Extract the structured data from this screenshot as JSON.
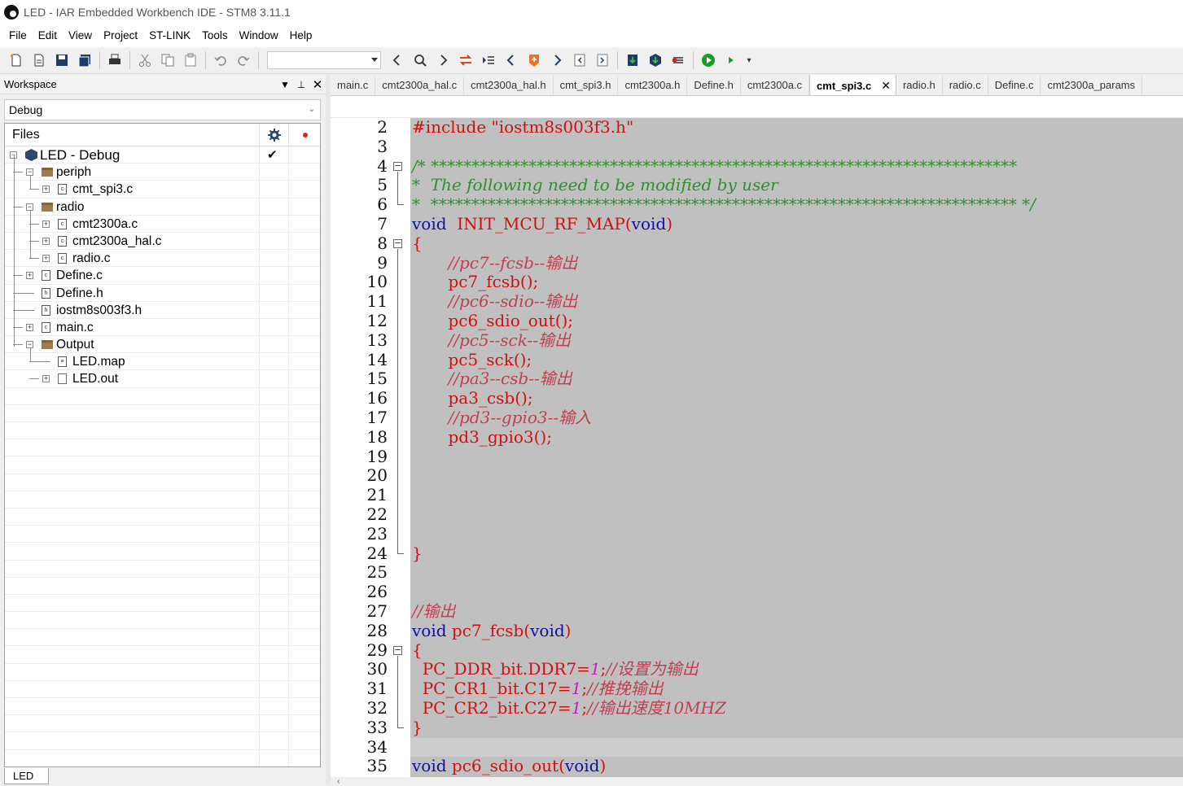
{
  "window": {
    "title": "LED - IAR Embedded Workbench IDE - STM8 3.11.1"
  },
  "menu": [
    "File",
    "Edit",
    "View",
    "Project",
    "ST-LINK",
    "Tools",
    "Window",
    "Help"
  ],
  "workspace": {
    "title": "Workspace",
    "config": "Debug",
    "files_header": "Files",
    "bottom_tab": "LED",
    "tree": [
      {
        "label": "LED - Debug",
        "kind": "project",
        "depth": 0,
        "expander": "-",
        "checked": true
      },
      {
        "label": "periph",
        "kind": "folder",
        "depth": 1,
        "expander": "-"
      },
      {
        "label": "cmt_spi3.c",
        "kind": "c",
        "depth": 2,
        "expander": "+"
      },
      {
        "label": "radio",
        "kind": "folder",
        "depth": 1,
        "expander": "-"
      },
      {
        "label": "cmt2300a.c",
        "kind": "c",
        "depth": 2,
        "expander": "+"
      },
      {
        "label": "cmt2300a_hal.c",
        "kind": "c",
        "depth": 2,
        "expander": "+"
      },
      {
        "label": "radio.c",
        "kind": "c",
        "depth": 2,
        "expander": "+"
      },
      {
        "label": "Define.c",
        "kind": "c",
        "depth": 1,
        "expander": "+"
      },
      {
        "label": "Define.h",
        "kind": "h",
        "depth": 1,
        "expander": ""
      },
      {
        "label": "iostm8s003f3.h",
        "kind": "h",
        "depth": 1,
        "expander": ""
      },
      {
        "label": "main.c",
        "kind": "c",
        "depth": 1,
        "expander": "+"
      },
      {
        "label": "Output",
        "kind": "folder",
        "depth": 1,
        "expander": "-"
      },
      {
        "label": "LED.map",
        "kind": "map",
        "depth": 2,
        "expander": ""
      },
      {
        "label": "LED.out",
        "kind": "out",
        "depth": 2,
        "expander": "+"
      }
    ]
  },
  "tabs": [
    {
      "label": "main.c"
    },
    {
      "label": "cmt2300a_hal.c"
    },
    {
      "label": "cmt2300a_hal.h"
    },
    {
      "label": "cmt_spi3.h"
    },
    {
      "label": "cmt2300a.h"
    },
    {
      "label": "Define.h"
    },
    {
      "label": "cmt2300a.c"
    },
    {
      "label": "cmt_spi3.c",
      "active": true
    },
    {
      "label": "radio.h"
    },
    {
      "label": "radio.c"
    },
    {
      "label": "Define.c"
    },
    {
      "label": "cmt2300a_params"
    }
  ],
  "code_lines": [
    {
      "n": "2",
      "text": "#include \"iostm8s003f3.h\""
    },
    {
      "n": "3",
      "text": ""
    },
    {
      "n": "4",
      "text": "/* ************************************************************************"
    },
    {
      "n": "5",
      "text": "*  The following need to be modified by user"
    },
    {
      "n": "6",
      "text": "*  ************************************************************************ */"
    },
    {
      "n": "7",
      "text": "void  INIT_MCU_RF_MAP(void)"
    },
    {
      "n": "8",
      "text": "{"
    },
    {
      "n": "9",
      "text": "       //pc7--fcsb--输出"
    },
    {
      "n": "10",
      "text": "       pc7_fcsb();"
    },
    {
      "n": "11",
      "text": "       //pc6--sdio--输出"
    },
    {
      "n": "12",
      "text": "       pc6_sdio_out();"
    },
    {
      "n": "13",
      "text": "       //pc5--sck--输出"
    },
    {
      "n": "14",
      "text": "       pc5_sck();"
    },
    {
      "n": "15",
      "text": "       //pa3--csb--输出"
    },
    {
      "n": "16",
      "text": "       pa3_csb();"
    },
    {
      "n": "17",
      "text": "       //pd3--gpio3--输入"
    },
    {
      "n": "18",
      "text": "       pd3_gpio3();"
    },
    {
      "n": "19",
      "text": ""
    },
    {
      "n": "20",
      "text": ""
    },
    {
      "n": "21",
      "text": ""
    },
    {
      "n": "22",
      "text": ""
    },
    {
      "n": "23",
      "text": ""
    },
    {
      "n": "24",
      "text": "}"
    },
    {
      "n": "25",
      "text": ""
    },
    {
      "n": "26",
      "text": ""
    },
    {
      "n": "27",
      "text": "//输出"
    },
    {
      "n": "28",
      "text": "void pc7_fcsb(void)"
    },
    {
      "n": "29",
      "text": "{"
    },
    {
      "n": "30",
      "text": "  PC_DDR_bit.DDR7=1;//设置为输出"
    },
    {
      "n": "31",
      "text": "  PC_CR1_bit.C17=1;//推挽输出"
    },
    {
      "n": "32",
      "text": "  PC_CR2_bit.C27=1;//输出速度10MHZ"
    },
    {
      "n": "33",
      "text": "}"
    },
    {
      "n": "34",
      "text": ""
    },
    {
      "n": "35",
      "text": "void pc6_sdio_out(void)"
    }
  ],
  "watermark": "https://blog.csdn.net/weixin_49542138"
}
